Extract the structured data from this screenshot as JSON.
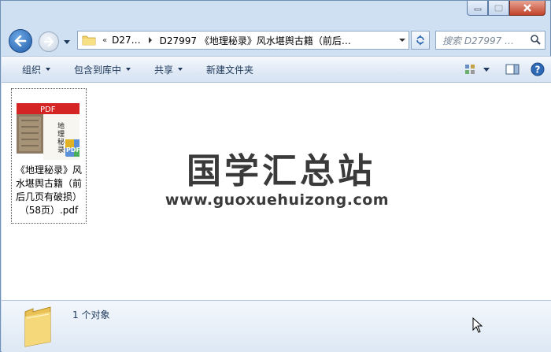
{
  "window": {
    "minimize_icon": "minimize-icon",
    "maximize_icon": "maximize-icon",
    "close_icon": "close-icon"
  },
  "nav": {
    "breadcrumb": {
      "overflow": "«",
      "segments": [
        "D27…",
        "D27997 《地理秘录》风水堪舆古籍（前后…"
      ]
    },
    "search_placeholder": "搜索 D27997 …"
  },
  "toolbar": {
    "items": [
      "组织",
      "包含到库中",
      "共享",
      "新建文件夹"
    ]
  },
  "files": [
    {
      "name": "《地理秘录》风水堪舆古籍（前后几页有破损）（58页）.pdf",
      "thumb_label": "PDF",
      "badge": "PDF"
    }
  ],
  "watermark": {
    "title": "国学汇总站",
    "url": "www.guoxuehuizong.com"
  },
  "status": {
    "text": "1 个对象"
  },
  "colors": {
    "pdf_red": "#d42424",
    "accent": "#1f5ca8"
  }
}
